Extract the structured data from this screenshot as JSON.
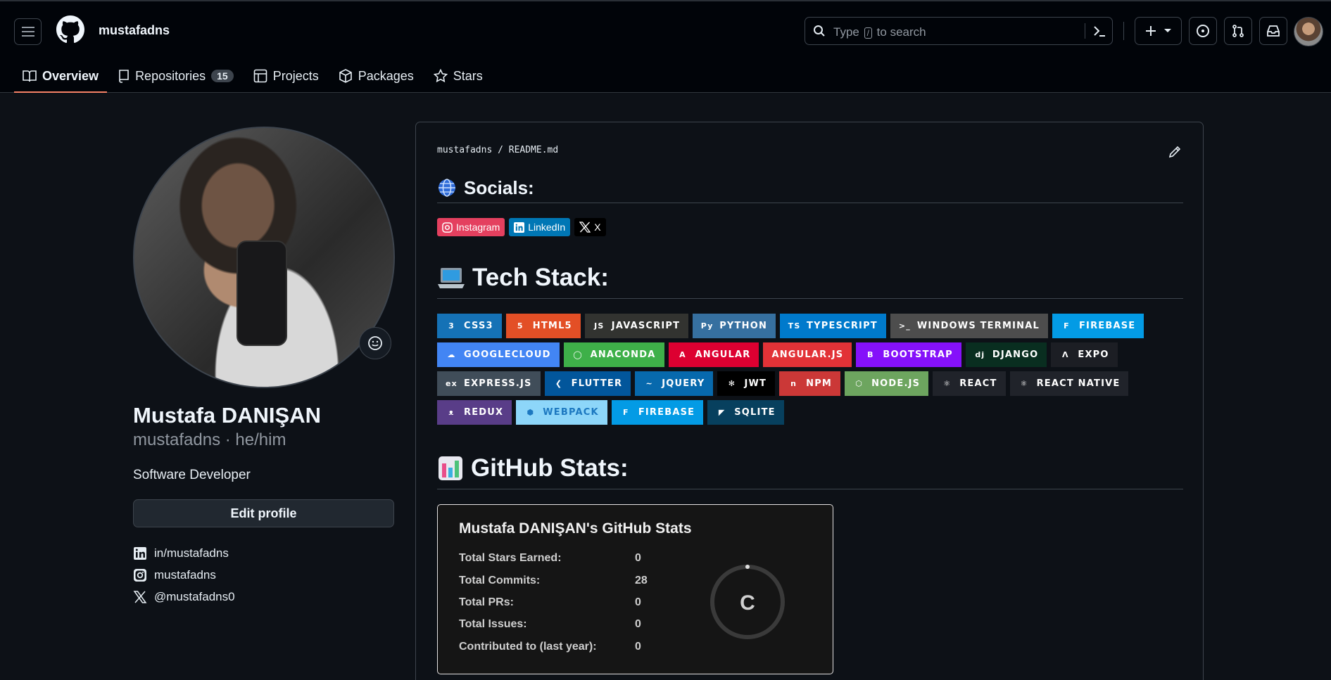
{
  "header": {
    "owner": "mustafadns",
    "search_prefix": "Type",
    "search_key": "/",
    "search_suffix": "to search"
  },
  "tabs": [
    {
      "label": "Overview",
      "icon": "book-icon"
    },
    {
      "label": "Repositories",
      "icon": "repo-icon",
      "count": "15"
    },
    {
      "label": "Projects",
      "icon": "table-icon"
    },
    {
      "label": "Packages",
      "icon": "package-icon"
    },
    {
      "label": "Stars",
      "icon": "star-icon"
    }
  ],
  "profile": {
    "full_name": "Mustafa DANIŞAN",
    "login_line": "mustafadns · he/him",
    "bio": "Software Developer",
    "edit_label": "Edit profile",
    "socials": [
      {
        "icon": "linkedin-icon",
        "text": "in/mustafadns"
      },
      {
        "icon": "instagram-icon",
        "text": "mustafadns"
      },
      {
        "icon": "x-icon",
        "text": "@mustafadns0"
      }
    ]
  },
  "readme": {
    "crumb_owner": "mustafadns",
    "crumb_sep": "/",
    "crumb_file": "README.md",
    "socials_heading": "Socials:",
    "social_badges": [
      {
        "label": "Instagram",
        "color": "#E4405F"
      },
      {
        "label": "LinkedIn",
        "color": "#0077B5"
      },
      {
        "label": "X",
        "color": "#000000"
      }
    ],
    "tech_heading": "Tech Stack:",
    "tech_rows": [
      [
        {
          "label": "CSS3",
          "color": "#1572B6",
          "icon": "css3-icon",
          "glyph": "3"
        },
        {
          "label": "HTML5",
          "color": "#E34F26",
          "icon": "html5-icon",
          "glyph": "5"
        },
        {
          "label": "JAVASCRIPT",
          "color": "#323330",
          "icon": "javascript-icon",
          "glyph": "JS"
        },
        {
          "label": "PYTHON",
          "color": "#3670A0",
          "icon": "python-icon",
          "glyph": "Py"
        },
        {
          "label": "TYPESCRIPT",
          "color": "#007ACC",
          "icon": "typescript-icon",
          "glyph": "TS"
        },
        {
          "label": "WINDOWS TERMINAL",
          "color": "#4D4D4D",
          "icon": "terminal-icon",
          "glyph": ">_"
        },
        {
          "label": "FIREBASE",
          "color": "#039BE5",
          "icon": "firebase-icon",
          "glyph": "F"
        }
      ],
      [
        {
          "label": "GOOGLECLOUD",
          "color": "#4285F4",
          "icon": "cloud-icon",
          "glyph": "☁"
        },
        {
          "label": "ANACONDA",
          "color": "#3EB049",
          "icon": "anaconda-icon",
          "glyph": "◯"
        },
        {
          "label": "ANGULAR",
          "color": "#DD0031",
          "icon": "angular-icon",
          "glyph": "A"
        },
        {
          "label": "ANGULAR.JS",
          "color": "#E23237",
          "icon": "",
          "glyph": ""
        },
        {
          "label": "BOOTSTRAP",
          "color": "#8511FA",
          "icon": "bootstrap-icon",
          "glyph": "B"
        },
        {
          "label": "DJANGO",
          "color": "#092E20",
          "icon": "django-icon",
          "glyph": "dj"
        },
        {
          "label": "EXPO",
          "color": "#1C1E24",
          "icon": "expo-icon",
          "glyph": "Λ"
        }
      ],
      [
        {
          "label": "EXPRESS.JS",
          "color": "#404D59",
          "icon": "express-icon",
          "glyph": "ex"
        },
        {
          "label": "FLUTTER",
          "color": "#02569B",
          "icon": "flutter-icon",
          "glyph": "❮"
        },
        {
          "label": "JQUERY",
          "color": "#0769AD",
          "icon": "jquery-icon",
          "glyph": "~"
        },
        {
          "label": "JWT",
          "color": "#000000",
          "icon": "jwt-icon",
          "glyph": "✻"
        },
        {
          "label": "NPM",
          "color": "#CB3837",
          "icon": "npm-icon",
          "glyph": "n"
        },
        {
          "label": "NODE.JS",
          "color": "#6DA55F",
          "icon": "nodejs-icon",
          "glyph": "⬡"
        },
        {
          "label": "REACT",
          "color": "#20232A",
          "icon": "react-icon",
          "glyph": "⚛"
        },
        {
          "label": "REACT NATIVE",
          "color": "#20232A",
          "icon": "react-icon",
          "glyph": "⚛"
        }
      ],
      [
        {
          "label": "REDUX",
          "color": "#593D88",
          "icon": "redux-icon",
          "glyph": "ᴥ"
        },
        {
          "label": "WEBPACK",
          "color": "#8DD6F9",
          "icon": "webpack-icon",
          "glyph": "⬢",
          "text_color": "#1C78C0"
        },
        {
          "label": "FIREBASE",
          "color": "#039BE5",
          "icon": "firebase-icon",
          "glyph": "F"
        },
        {
          "label": "SQLITE",
          "color": "#07405E",
          "icon": "sqlite-icon",
          "glyph": "◤"
        }
      ]
    ],
    "stats_heading": "GitHub Stats:",
    "stats_card": {
      "title": "Mustafa DANIŞAN's GitHub Stats",
      "rows": [
        {
          "label": "Total Stars Earned:",
          "value": "0"
        },
        {
          "label": "Total Commits:",
          "value": "28"
        },
        {
          "label": "Total PRs:",
          "value": "0"
        },
        {
          "label": "Total Issues:",
          "value": "0"
        },
        {
          "label": "Contributed to (last year):",
          "value": "0"
        }
      ],
      "rank": "C"
    }
  }
}
